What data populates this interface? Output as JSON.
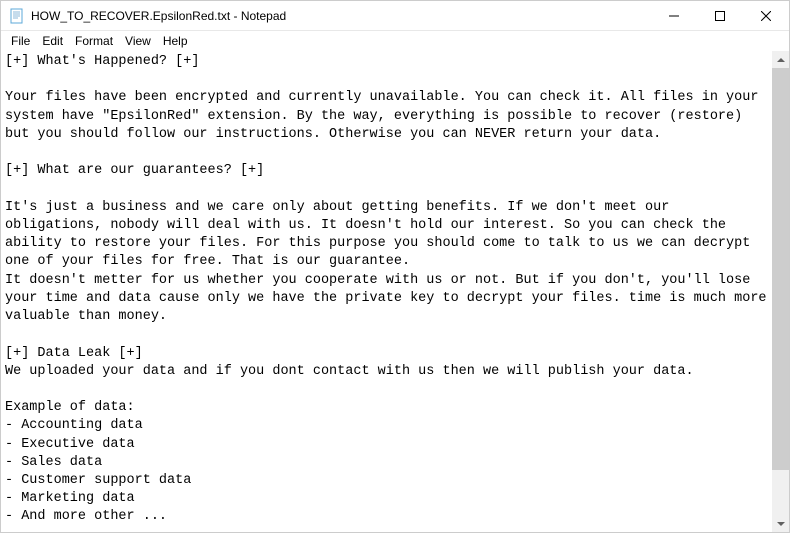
{
  "titlebar": {
    "title": "HOW_TO_RECOVER.EpsilonRed.txt - Notepad"
  },
  "menu": {
    "file": "File",
    "edit": "Edit",
    "format": "Format",
    "view": "View",
    "help": "Help"
  },
  "document": {
    "text": "[+] What's Happened? [+]\n\nYour files have been encrypted and currently unavailable. You can check it. All files in your system have \"EpsilonRed\" extension. By the way, everything is possible to recover (restore) but you should follow our instructions. Otherwise you can NEVER return your data.\n\n[+] What are our guarantees? [+]\n\nIt's just a business and we care only about getting benefits. If we don't meet our obligations, nobody will deal with us. It doesn't hold our interest. So you can check the ability to restore your files. For this purpose you should come to talk to us we can decrypt one of your files for free. That is our guarantee.\nIt doesn't metter for us whether you cooperate with us or not. But if you don't, you'll lose your time and data cause only we have the private key to decrypt your files. time is much more valuable than money.\n\n[+] Data Leak [+]\nWe uploaded your data and if you dont contact with us then we will publish your data.\n\nExample of data:\n- Accounting data\n- Executive data\n- Sales data\n- Customer support data\n- Marketing data\n- And more other ..."
  }
}
